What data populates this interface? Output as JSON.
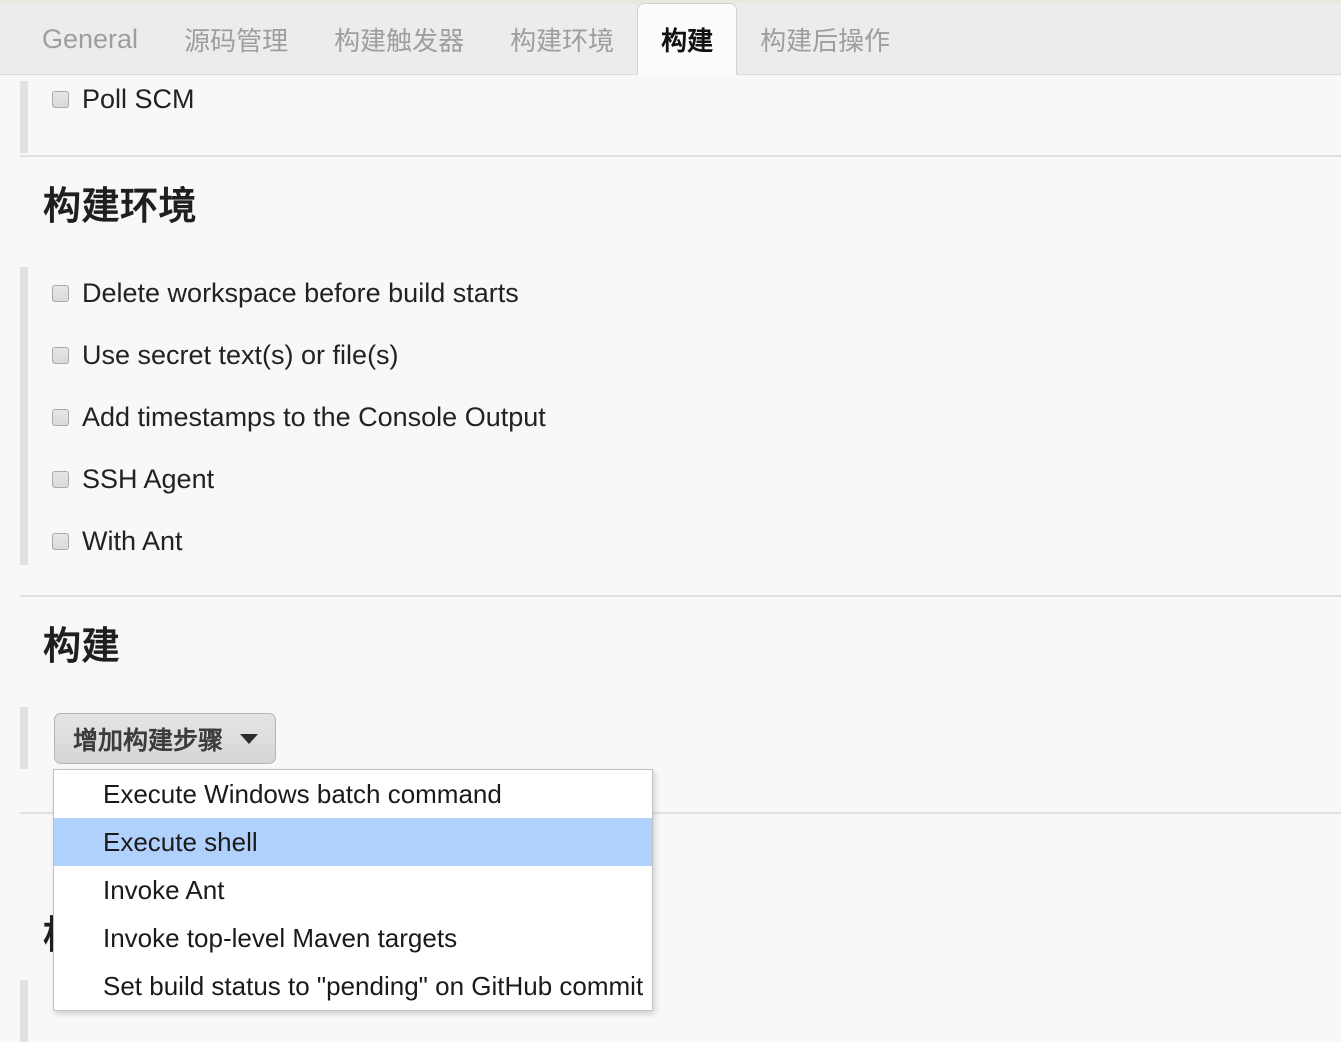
{
  "tabs": [
    {
      "label": "General",
      "active": false
    },
    {
      "label": "源码管理",
      "active": false
    },
    {
      "label": "构建触发器",
      "active": false
    },
    {
      "label": "构建环境",
      "active": false
    },
    {
      "label": "构建",
      "active": true
    },
    {
      "label": "构建后操作",
      "active": false
    }
  ],
  "top_section": {
    "checkbox_label": "Poll SCM"
  },
  "build_env_section": {
    "title": "构建环境",
    "checkboxes": [
      "Delete workspace before build starts",
      "Use secret text(s) or file(s)",
      "Add timestamps to the Console Output",
      "SSH Agent",
      "With Ant"
    ]
  },
  "build_section": {
    "title": "构建",
    "add_step_button": "增加构建步骤",
    "caret_icon": "chevron-down-icon"
  },
  "obscured_section": {
    "title": "构建后操作"
  },
  "dropdown_menu": {
    "items": [
      {
        "label": "Execute Windows batch command",
        "selected": false
      },
      {
        "label": "Execute shell",
        "selected": true
      },
      {
        "label": "Invoke Ant",
        "selected": false
      },
      {
        "label": "Invoke top-level Maven targets",
        "selected": false
      },
      {
        "label": "Set build status to \"pending\" on GitHub commit",
        "selected": false
      }
    ]
  },
  "colors": {
    "menu_highlight": "#b0d1fb",
    "tab_bar_bg": "#ececec",
    "content_bg": "#f8f8f8",
    "active_tab_bg": "#fbfbfb",
    "divider": "#e0e0e0",
    "marker": "#e2e2e2"
  }
}
